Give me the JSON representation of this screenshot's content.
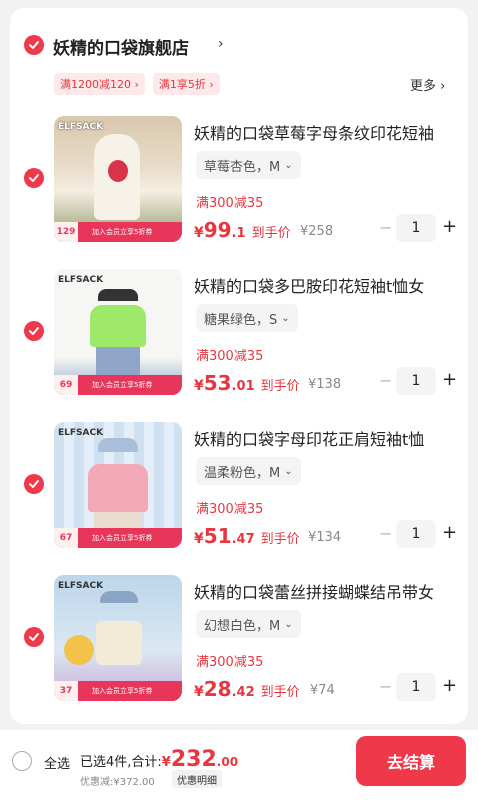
{
  "shop": {
    "name": "妖精的口袋旗舰店",
    "arrow": "›",
    "coupons": [
      "满1200减120 ›",
      "满1享5折 ›"
    ],
    "more": "更多 ›"
  },
  "items": [
    {
      "title": "妖精的口袋草莓字母条纹印花短袖",
      "sku": "草莓杏色，M",
      "promo": "满300减35",
      "price_int": "99",
      "price_dec": ".1",
      "price_label": "到手价",
      "orig": "¥258",
      "qty": "1",
      "thumb_price": "129",
      "thumb_tag": "ELFSACK",
      "thumb_text": "加入会员立享5折券",
      "scene_colors": [
        "#d9c7ad",
        "#f4eee2",
        "#8f9a6a"
      ]
    },
    {
      "title": "妖精的口袋多巴胺印花短袖t恤女",
      "sku": "糖果绿色，S",
      "promo": "满300减35",
      "price_int": "53",
      "price_dec": ".01",
      "price_label": "到手价",
      "orig": "¥138",
      "qty": "1",
      "thumb_price": "69",
      "thumb_tag": "ELFSACK",
      "thumb_text": "加入会员立享5折券",
      "scene_colors": [
        "#f6f6f4",
        "#9ee86a",
        "#8fa6c8"
      ]
    },
    {
      "title": "妖精的口袋字母印花正肩短袖t恤",
      "sku": "温柔粉色，M",
      "promo": "满300减35",
      "price_int": "51",
      "price_dec": ".47",
      "price_label": "到手价",
      "orig": "¥134",
      "qty": "1",
      "thumb_price": "67",
      "thumb_tag": "ELFSACK",
      "thumb_text": "加入会员立享5折券",
      "scene_colors": [
        "#cfe0f0",
        "#f2a8b6",
        "#e7dccd"
      ]
    },
    {
      "title": "妖精的口袋蕾丝拼接蝴蝶结吊带女",
      "sku": "幻想白色，M",
      "promo": "满300减35",
      "price_int": "28",
      "price_dec": ".42",
      "price_label": "到手价",
      "orig": "¥74",
      "qty": "1",
      "thumb_price": "37",
      "thumb_tag": "ELFSACK",
      "thumb_text": "加入会员立享5折券",
      "scene_colors": [
        "#bcd6ea",
        "#f3ead8",
        "#c9a9d6"
      ]
    }
  ],
  "bottom": {
    "select_all": "全选",
    "summary": "已选4件,合计:",
    "total_cur": "¥",
    "total_int": "232",
    "total_dec": ".00",
    "discount": "优惠减:¥372.00",
    "detail": "优惠明细",
    "checkout": "去结算"
  },
  "colors": {
    "accent": "#f0384b",
    "price": "#e8363f",
    "coupon_bg": "#fde9e9"
  },
  "icons": {
    "check": "check-icon",
    "chevron": "chevron-right-icon",
    "sku_dropdown": "chevron-down-icon"
  }
}
